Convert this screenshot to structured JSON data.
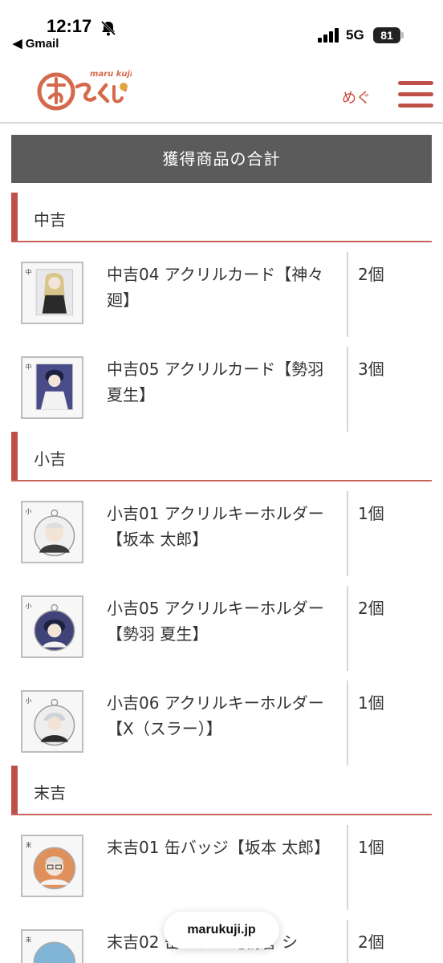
{
  "status_bar": {
    "time": "12:17",
    "back_app": "◀ Gmail",
    "network": "5G",
    "battery": "81"
  },
  "header": {
    "logo_text": "maru kuji",
    "user_name": "めぐ"
  },
  "banner": {
    "title": "獲得商品の合計"
  },
  "sections": [
    {
      "title": "中吉",
      "items": [
        {
          "name": "中吉04 アクリルカード【神々廻】",
          "qty": "2個"
        },
        {
          "name": "中吉05 アクリルカード【勢羽 夏生】",
          "qty": "3個"
        }
      ]
    },
    {
      "title": "小吉",
      "items": [
        {
          "name": "小吉01 アクリルキーホルダー【坂本 太郎】",
          "qty": "1個"
        },
        {
          "name": "小吉05 アクリルキーホルダー【勢羽 夏生】",
          "qty": "2個"
        },
        {
          "name": "小吉06 アクリルキーホルダー【X（スラー）】",
          "qty": "1個"
        }
      ]
    },
    {
      "title": "末吉",
      "items": [
        {
          "name": "末吉01 缶バッジ【坂本 太郎】",
          "qty": "1個"
        },
        {
          "name": "末吉02 缶バッジ【朝倉 シ",
          "qty": "2個"
        }
      ]
    }
  ],
  "url_bar": {
    "domain": "marukuji.jp"
  },
  "colors": {
    "accent": "#c0504a",
    "banner_bg": "#5b5b5b",
    "divider": "#d6d6d6"
  }
}
